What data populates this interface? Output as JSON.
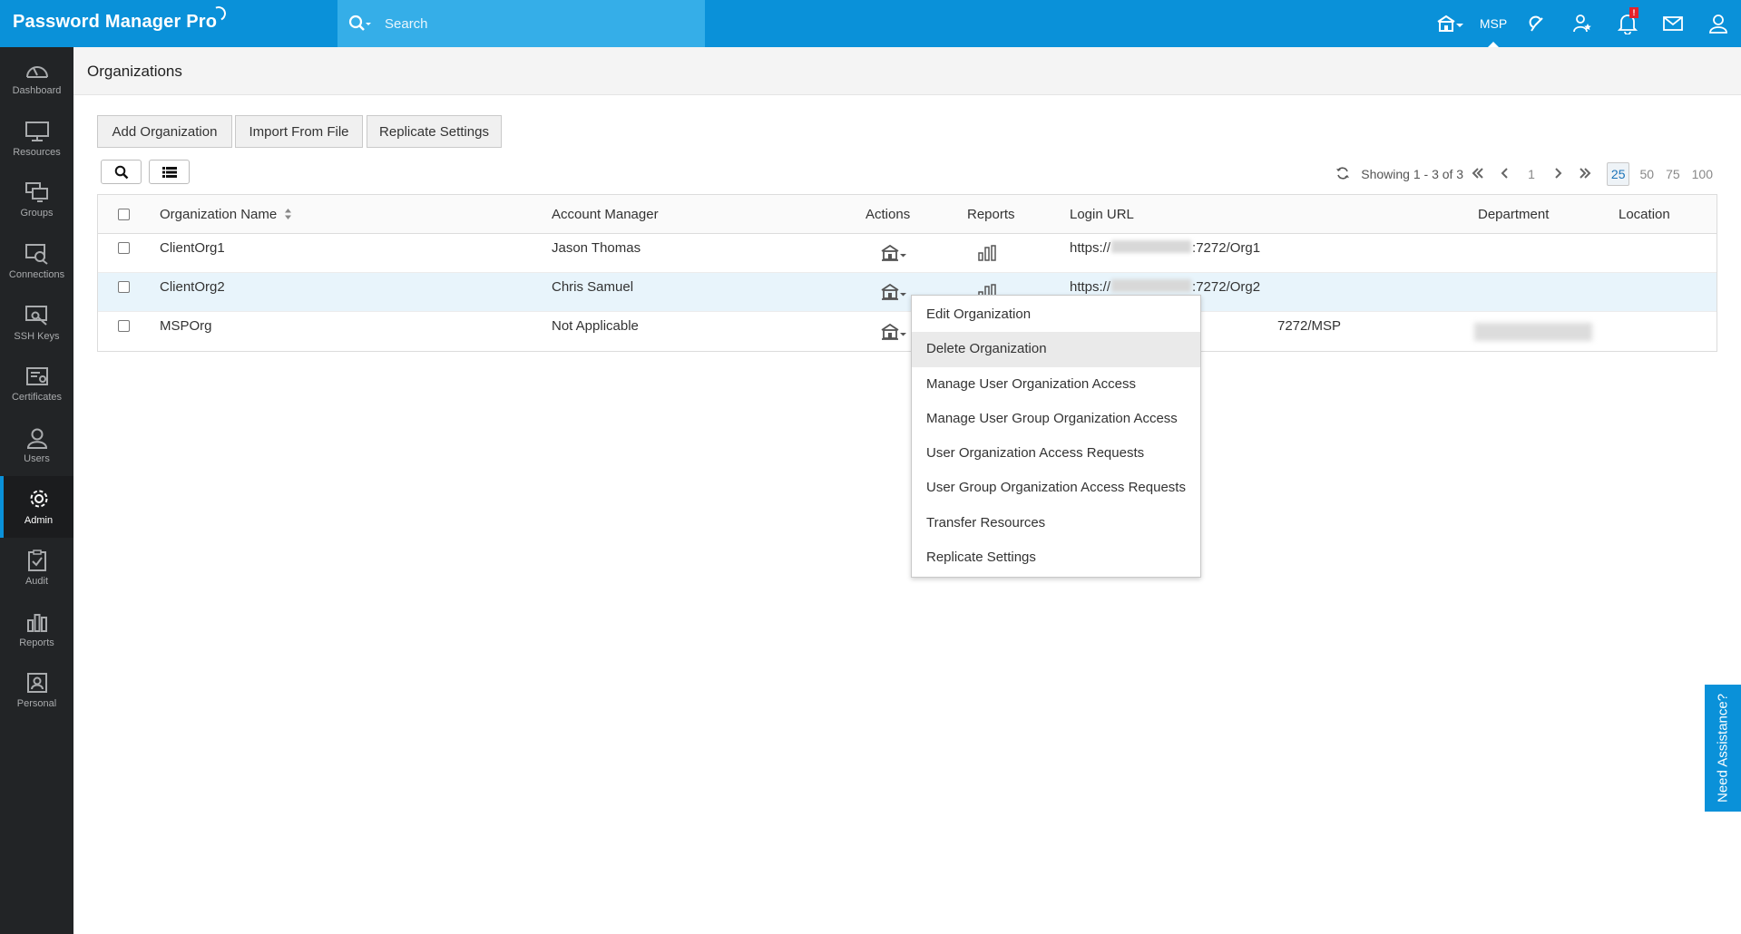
{
  "app": {
    "title": "Password Manager Pro"
  },
  "search": {
    "placeholder": "Search"
  },
  "topbar": {
    "org_label": "MSP",
    "notification_badge": "!"
  },
  "sidebar": {
    "items": [
      {
        "label": "Dashboard",
        "icon": "dashboard-icon"
      },
      {
        "label": "Resources",
        "icon": "monitor-icon"
      },
      {
        "label": "Groups",
        "icon": "groups-icon"
      },
      {
        "label": "Connections",
        "icon": "connections-icon"
      },
      {
        "label": "SSH Keys",
        "icon": "ssh-key-icon"
      },
      {
        "label": "Certificates",
        "icon": "certificate-icon"
      },
      {
        "label": "Users",
        "icon": "user-icon"
      },
      {
        "label": "Admin",
        "icon": "gear-icon",
        "active": true
      },
      {
        "label": "Audit",
        "icon": "audit-icon"
      },
      {
        "label": "Reports",
        "icon": "reports-icon"
      },
      {
        "label": "Personal",
        "icon": "personal-icon"
      }
    ]
  },
  "page": {
    "title": "Organizations"
  },
  "toolbar": {
    "add_label": "Add Organization",
    "import_label": "Import From File",
    "replicate_label": "Replicate Settings"
  },
  "pager": {
    "showing": "Showing 1 - 3 of 3",
    "page": "1",
    "sizes": [
      "25",
      "50",
      "75",
      "100"
    ],
    "selected_size": "25"
  },
  "table": {
    "columns": [
      "Organization Name",
      "Account Manager",
      "Actions",
      "Reports",
      "Login URL",
      "Department",
      "Location"
    ],
    "rows": [
      {
        "name": "ClientOrg1",
        "manager": "Jason Thomas",
        "url_prefix": "https://",
        "url_suffix": ":7272/Org1"
      },
      {
        "name": "ClientOrg2",
        "manager": "Chris Samuel",
        "url_prefix": "https://",
        "url_suffix": ":7272/Org2"
      },
      {
        "name": "MSPOrg",
        "manager": "Not Applicable",
        "url_prefix": "",
        "url_suffix": "7272/MSP"
      }
    ]
  },
  "menu": {
    "items": [
      "Edit Organization",
      "Delete Organization",
      "Manage User Organization Access",
      "Manage User Group Organization Access",
      "User Organization Access Requests",
      "User Group Organization Access Requests",
      "Transfer Resources",
      "Replicate Settings"
    ]
  },
  "help": {
    "label": "Need Assistance?"
  },
  "colors": {
    "brand": "#0a91d9",
    "sidebar": "#222426",
    "row_highlight": "#e8f4fb"
  }
}
